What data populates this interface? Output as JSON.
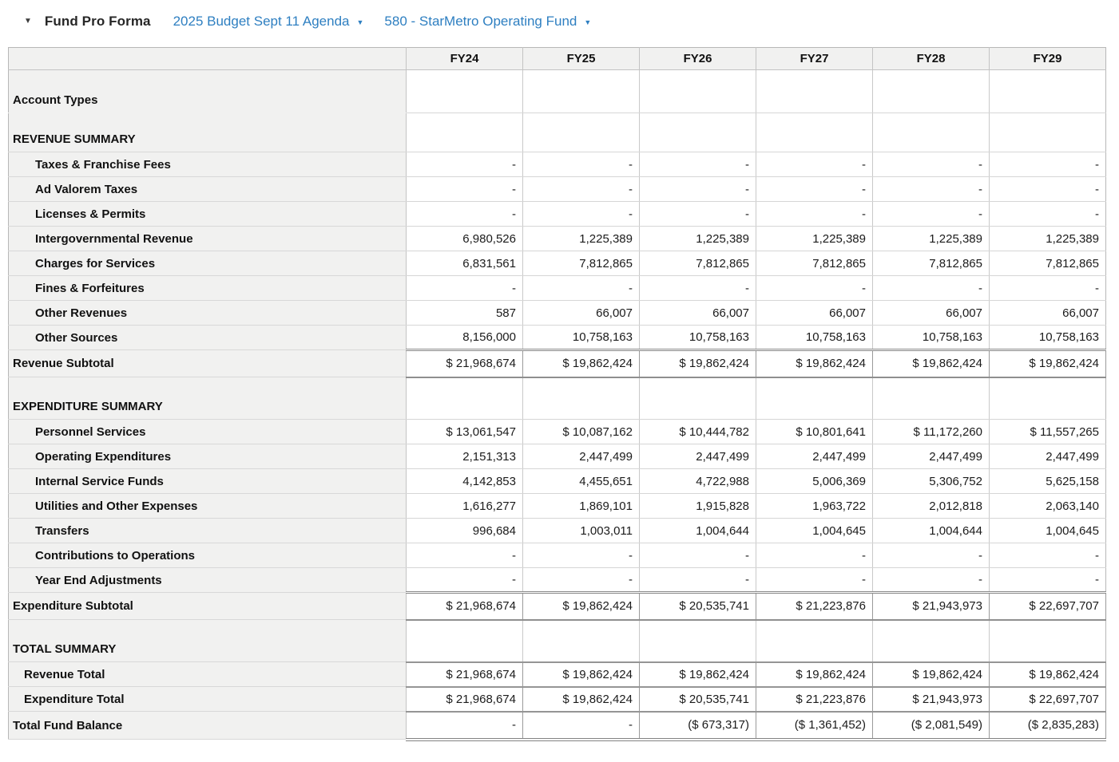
{
  "topbar": {
    "collapse_icon": "▼",
    "title": "Fund Pro Forma",
    "budget_dropdown": {
      "label": "2025 Budget Sept 11 Agenda",
      "caret_icon": "▼"
    },
    "fund_dropdown": {
      "label": "580 - StarMetro Operating Fund",
      "caret_icon": "▼"
    }
  },
  "colors": {
    "link_blue": "#2e7fc1",
    "header_bg": "#f1f1f0",
    "dark_rule": "#8f8f8f"
  },
  "table": {
    "columns": [
      "FY24",
      "FY25",
      "FY26",
      "FY27",
      "FY28",
      "FY29"
    ],
    "rows": [
      {
        "label": "Account Types",
        "kind": "section-top",
        "indent": 0,
        "values": [
          "",
          "",
          "",
          "",
          "",
          ""
        ]
      },
      {
        "label": "REVENUE SUMMARY",
        "kind": "section-mid",
        "indent": 0,
        "values": [
          "",
          "",
          "",
          "",
          "",
          ""
        ]
      },
      {
        "label": "Taxes & Franchise Fees",
        "kind": "item",
        "indent": 2,
        "values": [
          "-",
          "-",
          "-",
          "-",
          "-",
          "-"
        ]
      },
      {
        "label": "Ad Valorem Taxes",
        "kind": "item",
        "indent": 2,
        "values": [
          "-",
          "-",
          "-",
          "-",
          "-",
          "-"
        ]
      },
      {
        "label": "Licenses & Permits",
        "kind": "item",
        "indent": 2,
        "values": [
          "-",
          "-",
          "-",
          "-",
          "-",
          "-"
        ]
      },
      {
        "label": "Intergovernmental Revenue",
        "kind": "item",
        "indent": 2,
        "values": [
          "6,980,526",
          "1,225,389",
          "1,225,389",
          "1,225,389",
          "1,225,389",
          "1,225,389"
        ]
      },
      {
        "label": "Charges for Services",
        "kind": "item",
        "indent": 2,
        "values": [
          "6,831,561",
          "7,812,865",
          "7,812,865",
          "7,812,865",
          "7,812,865",
          "7,812,865"
        ]
      },
      {
        "label": "Fines & Forfeitures",
        "kind": "item",
        "indent": 2,
        "values": [
          "-",
          "-",
          "-",
          "-",
          "-",
          "-"
        ]
      },
      {
        "label": "Other Revenues",
        "kind": "item",
        "indent": 2,
        "values": [
          "587",
          "66,007",
          "66,007",
          "66,007",
          "66,007",
          "66,007"
        ]
      },
      {
        "label": "Other Sources",
        "kind": "item",
        "indent": 2,
        "values": [
          "8,156,000",
          "10,758,163",
          "10,758,163",
          "10,758,163",
          "10,758,163",
          "10,758,163"
        ]
      },
      {
        "label": "Revenue Subtotal",
        "kind": "subtotal",
        "indent": 0,
        "values": [
          "$ 21,968,674",
          "$ 19,862,424",
          "$ 19,862,424",
          "$ 19,862,424",
          "$ 19,862,424",
          "$ 19,862,424"
        ]
      },
      {
        "label": "EXPENDITURE SUMMARY",
        "kind": "section-tall",
        "indent": 0,
        "values": [
          "",
          "",
          "",
          "",
          "",
          ""
        ]
      },
      {
        "label": "Personnel Services",
        "kind": "item",
        "indent": 2,
        "values": [
          "$ 13,061,547",
          "$ 10,087,162",
          "$ 10,444,782",
          "$ 10,801,641",
          "$ 11,172,260",
          "$ 11,557,265"
        ]
      },
      {
        "label": "Operating Expenditures",
        "kind": "item",
        "indent": 2,
        "values": [
          "2,151,313",
          "2,447,499",
          "2,447,499",
          "2,447,499",
          "2,447,499",
          "2,447,499"
        ]
      },
      {
        "label": "Internal Service Funds",
        "kind": "item",
        "indent": 2,
        "values": [
          "4,142,853",
          "4,455,651",
          "4,722,988",
          "5,006,369",
          "5,306,752",
          "5,625,158"
        ]
      },
      {
        "label": "Utilities and Other Expenses",
        "kind": "item",
        "indent": 2,
        "values": [
          "1,616,277",
          "1,869,101",
          "1,915,828",
          "1,963,722",
          "2,012,818",
          "2,063,140"
        ]
      },
      {
        "label": "Transfers",
        "kind": "item",
        "indent": 2,
        "values": [
          "996,684",
          "1,003,011",
          "1,004,644",
          "1,004,645",
          "1,004,644",
          "1,004,645"
        ]
      },
      {
        "label": "Contributions to Operations",
        "kind": "item",
        "indent": 2,
        "values": [
          "-",
          "-",
          "-",
          "-",
          "-",
          "-"
        ]
      },
      {
        "label": "Year End Adjustments",
        "kind": "item",
        "indent": 2,
        "values": [
          "-",
          "-",
          "-",
          "-",
          "-",
          "-"
        ]
      },
      {
        "label": "Expenditure Subtotal",
        "kind": "subtotal",
        "indent": 0,
        "values": [
          "$ 21,968,674",
          "$ 19,862,424",
          "$ 20,535,741",
          "$ 21,223,876",
          "$ 21,943,973",
          "$ 22,697,707"
        ]
      },
      {
        "label": "TOTAL SUMMARY",
        "kind": "section-tall",
        "indent": 0,
        "values": [
          "",
          "",
          "",
          "",
          "",
          ""
        ]
      },
      {
        "label": "Revenue Total",
        "kind": "total",
        "indent": 1,
        "values": [
          "$ 21,968,674",
          "$ 19,862,424",
          "$ 19,862,424",
          "$ 19,862,424",
          "$ 19,862,424",
          "$ 19,862,424"
        ]
      },
      {
        "label": "Expenditure Total",
        "kind": "total",
        "indent": 1,
        "values": [
          "$ 21,968,674",
          "$ 19,862,424",
          "$ 20,535,741",
          "$ 21,223,876",
          "$ 21,943,973",
          "$ 22,697,707"
        ]
      },
      {
        "label": "Total Fund Balance",
        "kind": "grand",
        "indent": 0,
        "values": [
          "-",
          "-",
          "($ 673,317)",
          "($ 1,361,452)",
          "($ 2,081,549)",
          "($ 2,835,283)"
        ]
      }
    ]
  }
}
